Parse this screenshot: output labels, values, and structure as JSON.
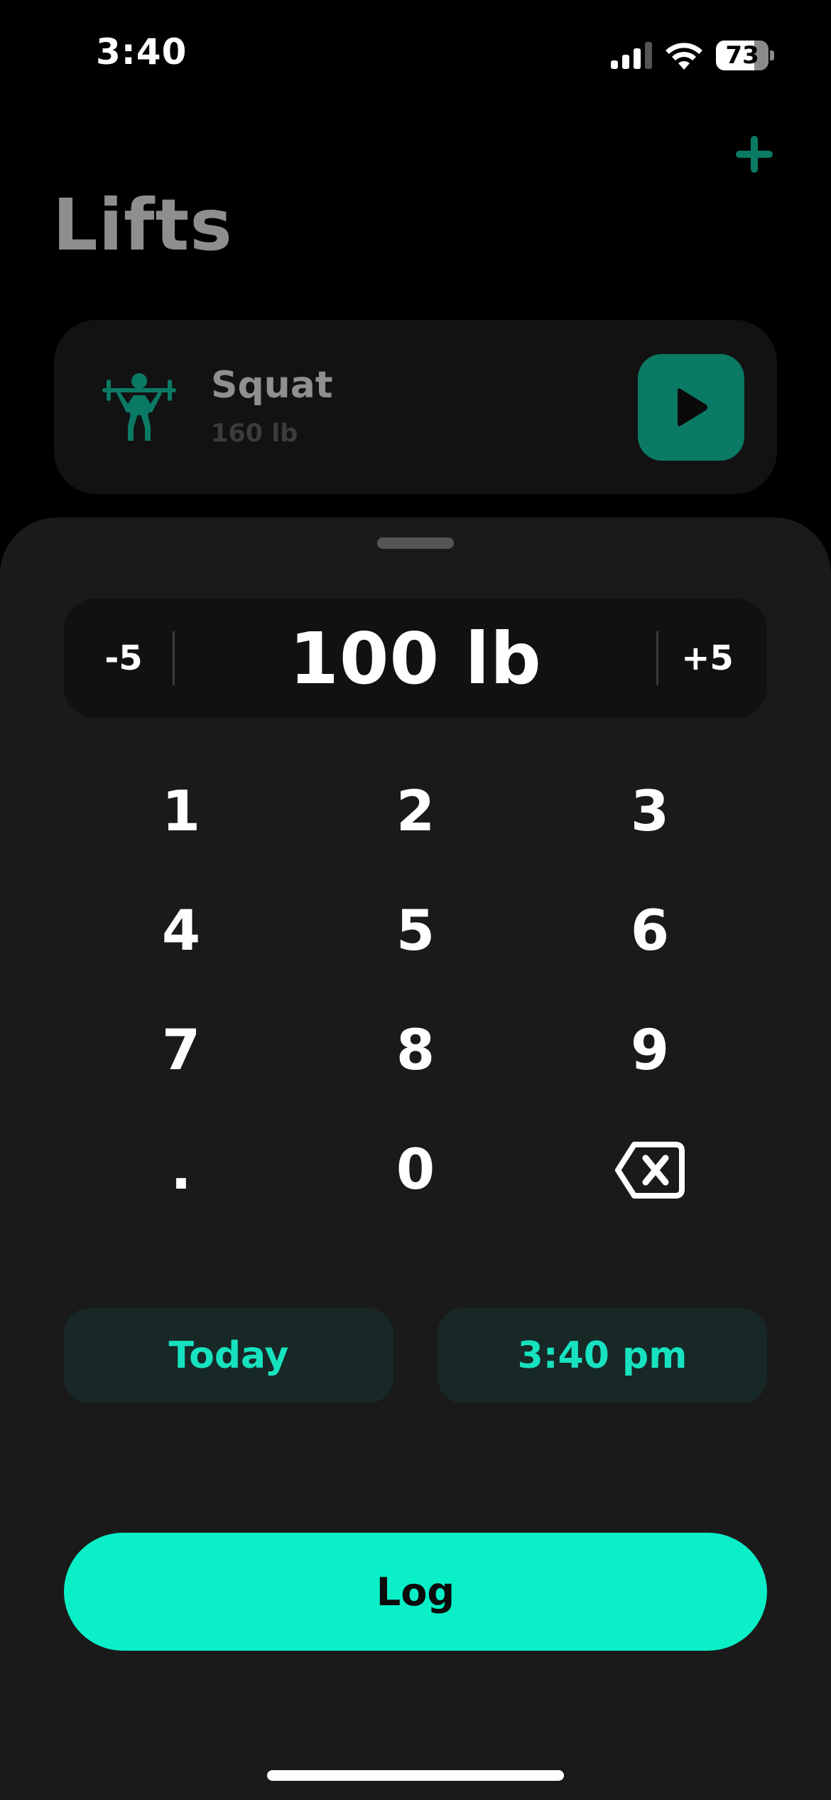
{
  "status_bar": {
    "time": "3:40",
    "battery_level": "73"
  },
  "header": {
    "title": "Lifts",
    "add_icon": "plus-icon"
  },
  "lift_card": {
    "name": "Squat",
    "weight": "160 lb",
    "icon": "weightlifter-icon",
    "action_icon": "play-icon"
  },
  "entry": {
    "decrement_label": "-5",
    "value": "100 lb",
    "increment_label": "+5"
  },
  "keypad": {
    "keys": [
      "1",
      "2",
      "3",
      "4",
      "5",
      "6",
      "7",
      "8",
      "9",
      ".",
      "0"
    ],
    "backspace_icon": "backspace-icon"
  },
  "date_time": {
    "date_label": "Today",
    "time_label": "3:40 pm"
  },
  "actions": {
    "log_label": "Log"
  },
  "colors": {
    "background": "#000000",
    "sheet": "#1a1a1a",
    "accent": "#0aefc7",
    "accent_dark": "#0b7a64",
    "accent_text": "#17e2c0",
    "chip_background": "#172826",
    "muted_text": "#8e8e8e"
  }
}
